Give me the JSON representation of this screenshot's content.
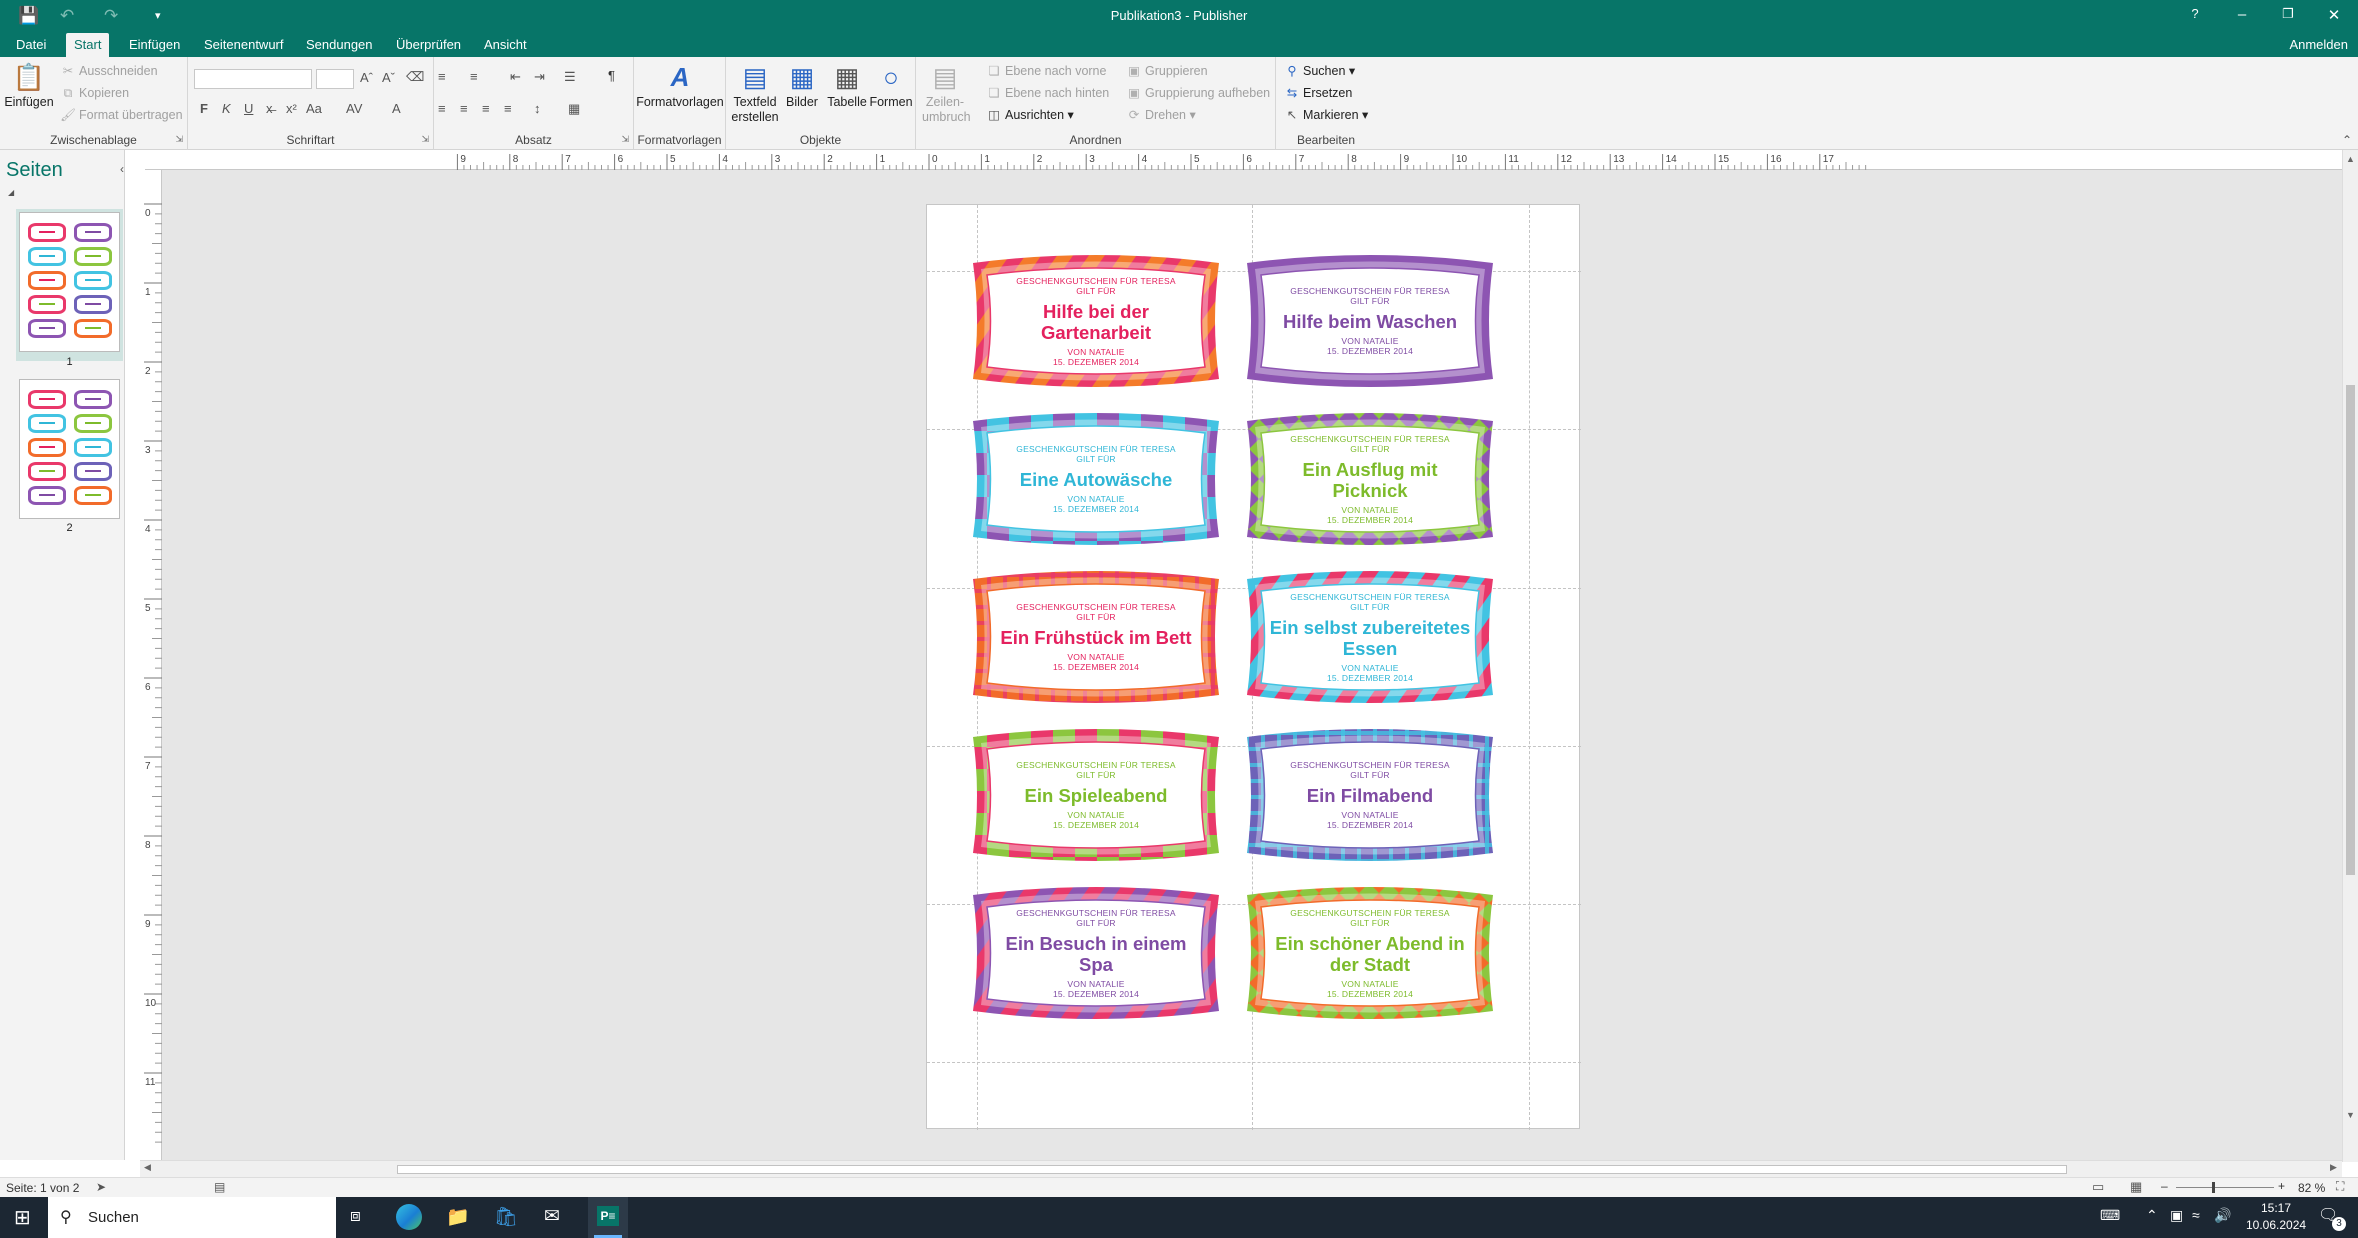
{
  "app": {
    "title": "Publikation3 - Publisher",
    "help": "?",
    "signin": "Anmelden"
  },
  "tabs": [
    {
      "label": "Datei"
    },
    {
      "label": "Start"
    },
    {
      "label": "Einfügen"
    },
    {
      "label": "Seitenentwurf"
    },
    {
      "label": "Sendungen"
    },
    {
      "label": "Überprüfen"
    },
    {
      "label": "Ansicht"
    }
  ],
  "ribbon": {
    "clipboard": {
      "paste": "Einfügen",
      "cut": "Ausschneiden",
      "copy": "Kopieren",
      "format_painter": "Format übertragen",
      "label": "Zwischenablage"
    },
    "font": {
      "bold": "F",
      "italic": "K",
      "underline": "U",
      "label": "Schriftart"
    },
    "paragraph": {
      "pilcrow": "¶",
      "label": "Absatz"
    },
    "styles": {
      "button": "Formatvorlagen",
      "label": "Formatvorlagen"
    },
    "objects": {
      "textbox_line1": "Textfeld",
      "textbox_line2": "erstellen",
      "pictures": "Bilder",
      "table": "Tabelle",
      "shapes": "Formen",
      "label": "Objekte"
    },
    "arrange": {
      "wrap_line1": "Zeilen-",
      "wrap_line2": "umbruch",
      "bring_forward": "Ebene nach vorne",
      "send_backward": "Ebene nach hinten",
      "align": "Ausrichten",
      "group": "Gruppieren",
      "ungroup": "Gruppierung aufheben",
      "rotate": "Drehen",
      "label": "Anordnen"
    },
    "editing": {
      "find": "Suchen",
      "replace": "Ersetzen",
      "select": "Markieren",
      "label": "Bearbeiten"
    }
  },
  "pages_pane": {
    "title": "Seiten",
    "pages": [
      {
        "number": "1"
      },
      {
        "number": "2"
      }
    ]
  },
  "ruler": {
    "horizontal": [
      "9",
      "8",
      "7",
      "6",
      "5",
      "4",
      "3",
      "2",
      "1",
      "0",
      "1",
      "2",
      "3",
      "4",
      "5",
      "6",
      "7",
      "8",
      "9",
      "10",
      "11",
      "12",
      "13",
      "14",
      "15",
      "16",
      "17"
    ],
    "vertical": [
      "0",
      "1",
      "2",
      "3",
      "4",
      "5",
      "6",
      "7",
      "8",
      "9",
      "10",
      "11"
    ]
  },
  "vouchers": [
    {
      "header_line1": "GESCHENKGUTSCHEIN FÜR TERESA",
      "header_line2": "GILT FÜR",
      "title": "Hilfe bei der Gartenarbeit",
      "from": "VON NATALIE",
      "date": "15. DEZEMBER 2014",
      "text_color": "#e4215e",
      "pattern": "diagonal",
      "colors": [
        "#e9386a",
        "#f47b2a"
      ]
    },
    {
      "header_line1": "GESCHENKGUTSCHEIN FÜR TERESA",
      "header_line2": "GILT FÜR",
      "title": "Hilfe beim Waschen",
      "from": "VON NATALIE",
      "date": "15. DEZEMBER 2014",
      "text_color": "#7f4ba3",
      "pattern": "solid",
      "colors": [
        "#8d55b2",
        "#c8a2dc"
      ]
    },
    {
      "header_line1": "GESCHENKGUTSCHEIN FÜR TERESA",
      "header_line2": "GILT FÜR",
      "title": "Eine Autowäsche",
      "from": "VON NATALIE",
      "date": "15. DEZEMBER 2014",
      "text_color": "#2fb6d6",
      "pattern": "blocks",
      "colors": [
        "#42c3e2",
        "#8d55b2"
      ]
    },
    {
      "header_line1": "GESCHENKGUTSCHEIN FÜR TERESA",
      "header_line2": "GILT FÜR",
      "title": "Ein Ausflug mit Picknick",
      "from": "VON NATALIE",
      "date": "15. DEZEMBER 2014",
      "text_color": "#7dbb2b",
      "pattern": "zigzag",
      "colors": [
        "#8cc63f",
        "#8d55b2"
      ]
    },
    {
      "header_line1": "GESCHENKGUTSCHEIN FÜR TERESA",
      "header_line2": "GILT FÜR",
      "title": "Ein Frühstück im Bett",
      "from": "VON NATALIE",
      "date": "15. DEZEMBER 2014",
      "text_color": "#e4215e",
      "pattern": "plaid",
      "colors": [
        "#f26b2a",
        "#e9386a"
      ]
    },
    {
      "header_line1": "GESCHENKGUTSCHEIN FÜR TERESA",
      "header_line2": "GILT FÜR",
      "title": "Ein selbst zubereitetes Essen",
      "from": "VON NATALIE",
      "date": "15. DEZEMBER 2014",
      "text_color": "#2fb6d6",
      "pattern": "diagonal",
      "colors": [
        "#42c3e2",
        "#e9386a"
      ]
    },
    {
      "header_line1": "GESCHENKGUTSCHEIN FÜR TERESA",
      "header_line2": "GILT FÜR",
      "title": "Ein Spieleabend",
      "from": "VON NATALIE",
      "date": "15. DEZEMBER 2014",
      "text_color": "#7dbb2b",
      "pattern": "blocks",
      "colors": [
        "#e9386a",
        "#8cc63f"
      ]
    },
    {
      "header_line1": "GESCHENKGUTSCHEIN FÜR TERESA",
      "header_line2": "GILT FÜR",
      "title": "Ein Filmabend",
      "from": "VON NATALIE",
      "date": "15. DEZEMBER 2014",
      "text_color": "#7f4ba3",
      "pattern": "plaid",
      "colors": [
        "#6d62b8",
        "#42c3e2"
      ]
    },
    {
      "header_line1": "GESCHENKGUTSCHEIN FÜR TERESA",
      "header_line2": "GILT FÜR",
      "title": "Ein Besuch in einem Spa",
      "from": "VON NATALIE",
      "date": "15. DEZEMBER 2014",
      "text_color": "#7f4ba3",
      "pattern": "diagonal",
      "colors": [
        "#8d55b2",
        "#e9386a"
      ]
    },
    {
      "header_line1": "GESCHENKGUTSCHEIN FÜR TERESA",
      "header_line2": "GILT FÜR",
      "title": "Ein schöner Abend in der Stadt",
      "from": "VON NATALIE",
      "date": "15. DEZEMBER 2014",
      "text_color": "#7dbb2b",
      "pattern": "zigzag",
      "colors": [
        "#f26b2a",
        "#8cc63f"
      ]
    }
  ],
  "status": {
    "page": "Seite: 1 von 2",
    "zoom": "82 %"
  },
  "taskbar": {
    "search": "Suchen",
    "time": "15:17",
    "date": "10.06.2024",
    "notifications": "3"
  }
}
